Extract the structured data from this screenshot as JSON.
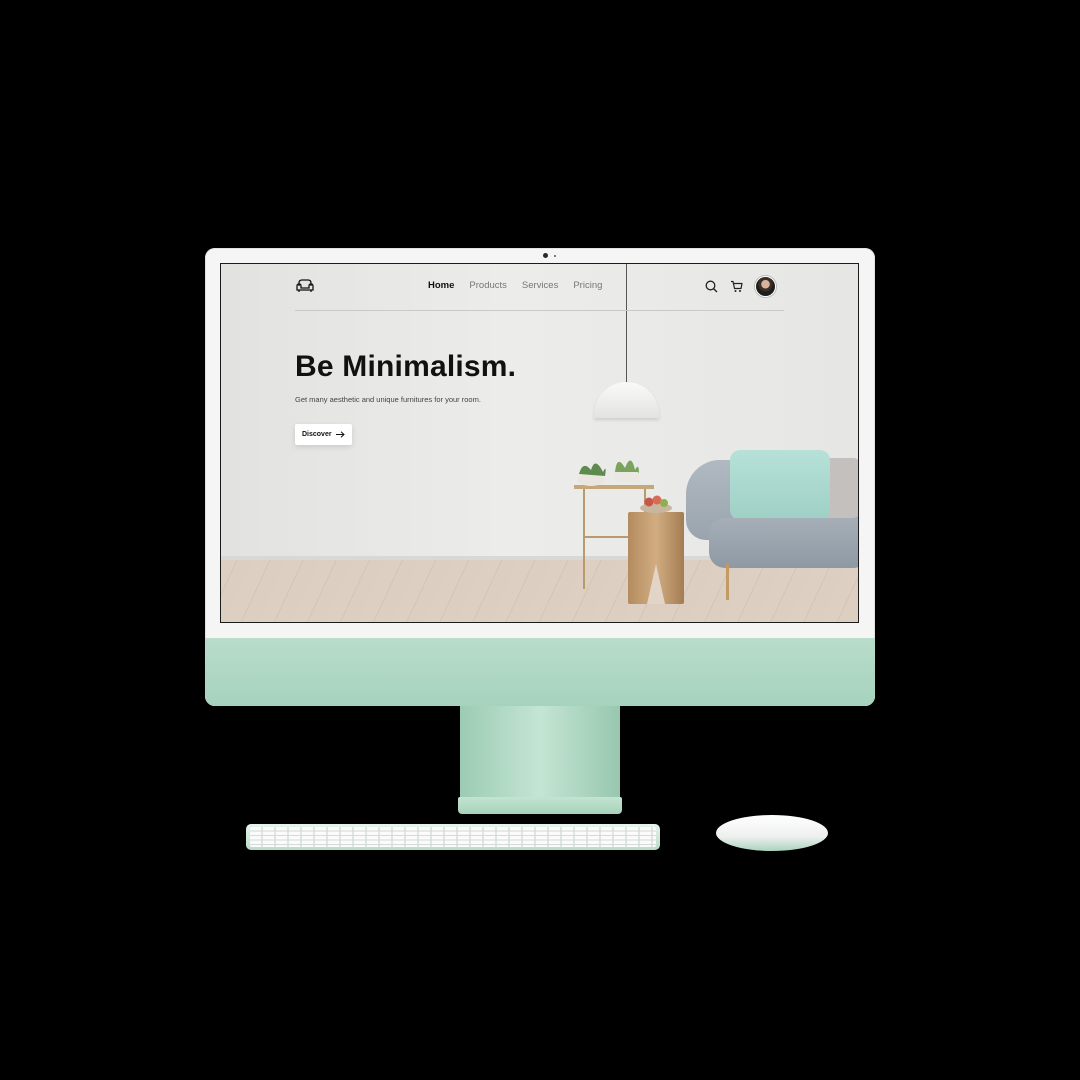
{
  "nav": {
    "logo_icon": "armchair-icon",
    "menu": [
      {
        "label": "Home",
        "active": true
      },
      {
        "label": "Products",
        "active": false
      },
      {
        "label": "Services",
        "active": false
      },
      {
        "label": "Pricing",
        "active": false
      }
    ],
    "icons": [
      "search-icon",
      "cart-icon",
      "avatar"
    ]
  },
  "hero": {
    "title": "Be Minimalism.",
    "subtitle": "Get many aesthetic and unique furnitures for your room.",
    "button_label": "Discover",
    "button_icon": "arrow-right-icon"
  },
  "colors": {
    "device_accent": "#a8d4bf",
    "screen_background": "#e6e6e4",
    "text_primary": "#111111",
    "pillow": "#a7d7cb"
  }
}
